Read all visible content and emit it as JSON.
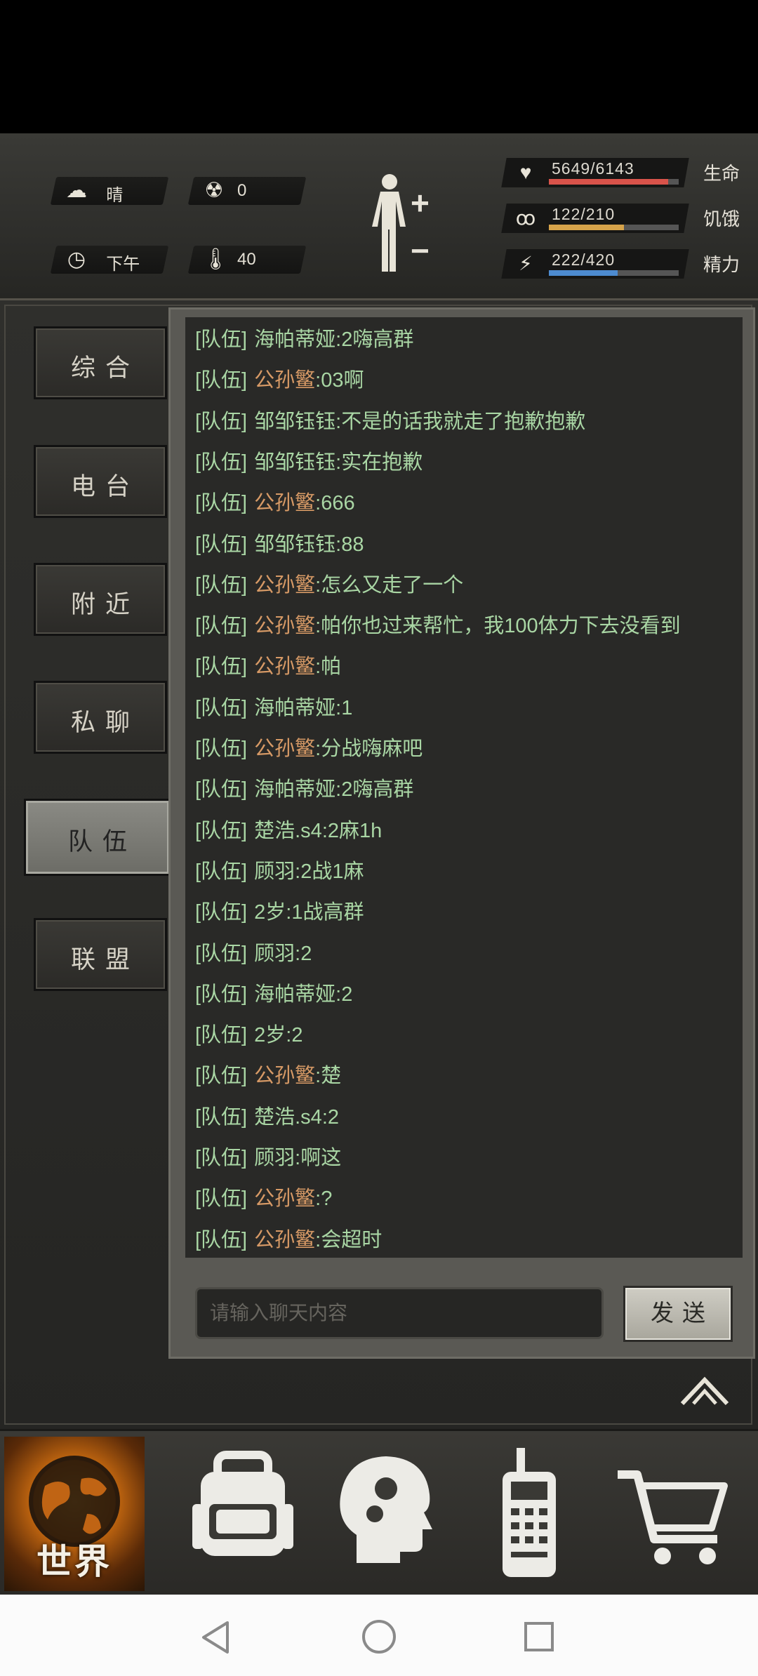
{
  "hud": {
    "weather": "晴",
    "radiation": "0",
    "time_of_day": "下午",
    "temperature": "40"
  },
  "stats": [
    {
      "label": "生命",
      "value": "5649/6143",
      "fill": 0.92,
      "color": "#d9534a",
      "icon": "heart-rate-icon"
    },
    {
      "label": "饥饿",
      "value": "122/210",
      "fill": 0.58,
      "color": "#d6a34a",
      "icon": "stomach-icon"
    },
    {
      "label": "精力",
      "value": "222/420",
      "fill": 0.53,
      "color": "#4d8bd0",
      "icon": "energy-head-icon"
    }
  ],
  "tabs": [
    {
      "label": "综合",
      "active": false
    },
    {
      "label": "电台",
      "active": false
    },
    {
      "label": "附近",
      "active": false
    },
    {
      "label": "私聊",
      "active": false
    },
    {
      "label": "队伍",
      "active": true
    },
    {
      "label": "联盟",
      "active": false
    }
  ],
  "channel_tag": "[队伍]",
  "messages": [
    {
      "name": "海帕蒂娅",
      "text": ":2嗨高群",
      "color": "green"
    },
    {
      "name": "公孙鳘",
      "text": ":03啊",
      "color": "orange"
    },
    {
      "name": "邹邹钰钰",
      "text": ":不是的话我就走了抱歉抱歉",
      "color": "green"
    },
    {
      "name": "邹邹钰钰",
      "text": ":实在抱歉",
      "color": "green"
    },
    {
      "name": "公孙鳘",
      "text": ":666",
      "color": "orange"
    },
    {
      "name": "邹邹钰钰",
      "text": ":88",
      "color": "green"
    },
    {
      "name": "公孙鳘",
      "text": ":怎么又走了一个",
      "color": "orange"
    },
    {
      "name": "公孙鳘",
      "text": ":帕你也过来帮忙，我100体力下去没看到",
      "color": "orange"
    },
    {
      "name": "公孙鳘",
      "text": ":帕",
      "color": "orange"
    },
    {
      "name": "海帕蒂娅",
      "text": ":1",
      "color": "green"
    },
    {
      "name": "公孙鳘",
      "text": ":分战嗨麻吧",
      "color": "orange"
    },
    {
      "name": "海帕蒂娅",
      "text": ":2嗨高群",
      "color": "green"
    },
    {
      "name": "楚浩.s4",
      "text": ":2麻1h",
      "color": "green"
    },
    {
      "name": "顾羽",
      "text": ":2战1麻",
      "color": "green"
    },
    {
      "name": "2岁",
      "text": ":1战高群",
      "color": "green"
    },
    {
      "name": "顾羽",
      "text": ":2",
      "color": "green"
    },
    {
      "name": "海帕蒂娅",
      "text": ":2",
      "color": "green"
    },
    {
      "name": "2岁",
      "text": ":2",
      "color": "green"
    },
    {
      "name": "公孙鳘",
      "text": ":楚",
      "color": "orange"
    },
    {
      "name": "楚浩.s4",
      "text": ":2",
      "color": "green"
    },
    {
      "name": "顾羽",
      "text": ":啊这",
      "color": "green"
    },
    {
      "name": "公孙鳘",
      "text": ":?",
      "color": "orange"
    },
    {
      "name": "公孙鳘",
      "text": ":会超时",
      "color": "orange"
    }
  ],
  "input": {
    "placeholder": "请输入聊天内容",
    "value": ""
  },
  "send_label": "发送",
  "nav": {
    "world_label": "世界",
    "items": [
      "globe-icon",
      "backpack-icon",
      "skills-head-icon",
      "walkie-talkie-icon",
      "shopping-cart-icon"
    ]
  }
}
